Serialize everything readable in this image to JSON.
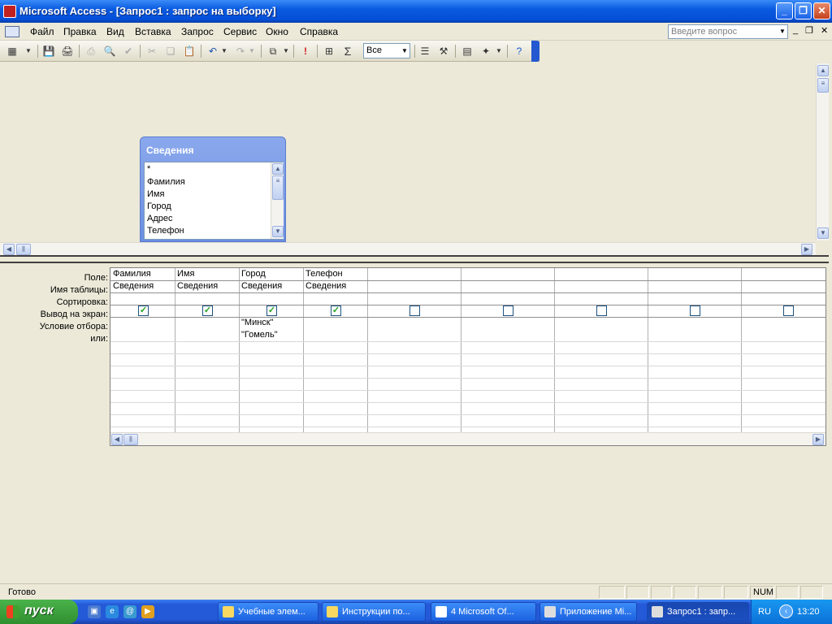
{
  "window": {
    "title": "Microsoft Access - [Запрос1 : запрос на выборку]"
  },
  "menu": {
    "items": [
      "Файл",
      "Правка",
      "Вид",
      "Вставка",
      "Запрос",
      "Сервис",
      "Окно",
      "Справка"
    ],
    "ask_placeholder": "Введите вопрос"
  },
  "toolbar": {
    "icons": [
      "view-icon",
      "save-icon",
      "print-preview-icon",
      "print-icon",
      "search-icon",
      "spelling-icon",
      "cut-icon",
      "copy-icon",
      "paste-icon",
      "undo-icon",
      "redo-icon",
      "query-type-icon",
      "run-icon",
      "show-table-icon",
      "totals-icon",
      "properties-icon",
      "build-icon",
      "database-window-icon",
      "new-object-icon",
      "help-icon"
    ],
    "top_values": "Все"
  },
  "table_box": {
    "title": "Сведения",
    "fields": [
      "*",
      "Фамилия",
      "Имя",
      "Город",
      "Адрес",
      "Телефон"
    ]
  },
  "grid": {
    "row_labels": [
      "Поле:",
      "Имя таблицы:",
      "Сортировка:",
      "Вывод на экран:",
      "Условие отбора:",
      "или:"
    ],
    "columns": [
      {
        "field": "Фамилия",
        "table": "Сведения",
        "sort": "",
        "show": true,
        "criteria": "",
        "or": ""
      },
      {
        "field": "Имя",
        "table": "Сведения",
        "sort": "",
        "show": true,
        "criteria": "",
        "or": ""
      },
      {
        "field": "Город",
        "table": "Сведения",
        "sort": "",
        "show": true,
        "criteria": "\"Минск\"",
        "or": "\"Гомель\""
      },
      {
        "field": "Телефон",
        "table": "Сведения",
        "sort": "",
        "show": true,
        "criteria": "",
        "or": ""
      },
      {
        "field": "",
        "table": "",
        "sort": "",
        "show": false,
        "criteria": "",
        "or": ""
      },
      {
        "field": "",
        "table": "",
        "sort": "",
        "show": false,
        "criteria": "",
        "or": ""
      },
      {
        "field": "",
        "table": "",
        "sort": "",
        "show": false,
        "criteria": "",
        "or": ""
      },
      {
        "field": "",
        "table": "",
        "sort": "",
        "show": false,
        "criteria": "",
        "or": ""
      },
      {
        "field": "",
        "table": "",
        "sort": "",
        "show": false,
        "criteria": "",
        "or": ""
      }
    ]
  },
  "status": {
    "text": "Готово",
    "num": "NUM"
  },
  "taskbar": {
    "start": "пуск",
    "tasks": [
      "Учебные элем...",
      "Инструкции по...",
      "4 Microsoft Of...",
      "Приложение Mi...",
      "Запрос1 : запр..."
    ],
    "lang": "RU",
    "clock": "13:20"
  },
  "colors": {
    "title_blue": "#0450d8",
    "taskbar_blue": "#2459d8",
    "start_green": "#2f8f2f",
    "check_green": "#21a121"
  }
}
